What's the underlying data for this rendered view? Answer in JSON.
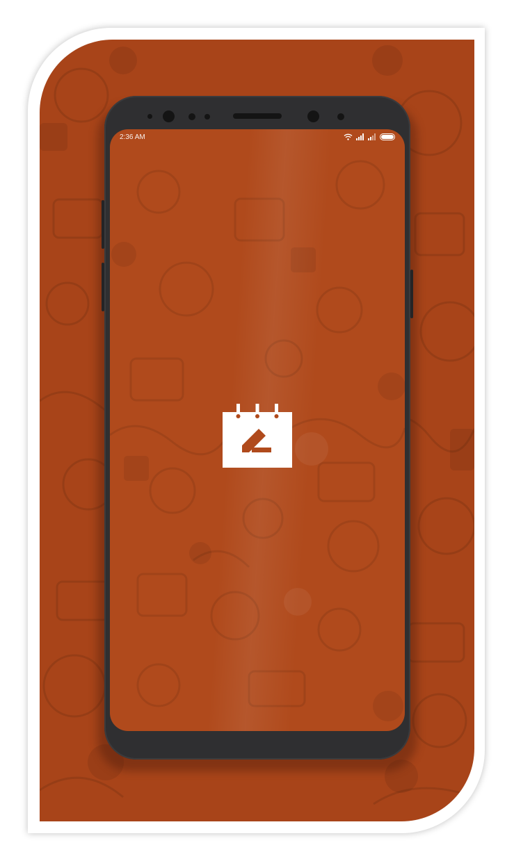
{
  "status_bar": {
    "time": "2:36 AM",
    "icons": [
      "wifi-icon",
      "signal-icon",
      "signal-icon",
      "battery-icon"
    ]
  },
  "app": {
    "icon": "calendar-edit-icon"
  },
  "colors": {
    "background": "#a84419",
    "screen": "#b04a1c",
    "phone_body": "#2f2f31",
    "icon": "#ffffff"
  }
}
